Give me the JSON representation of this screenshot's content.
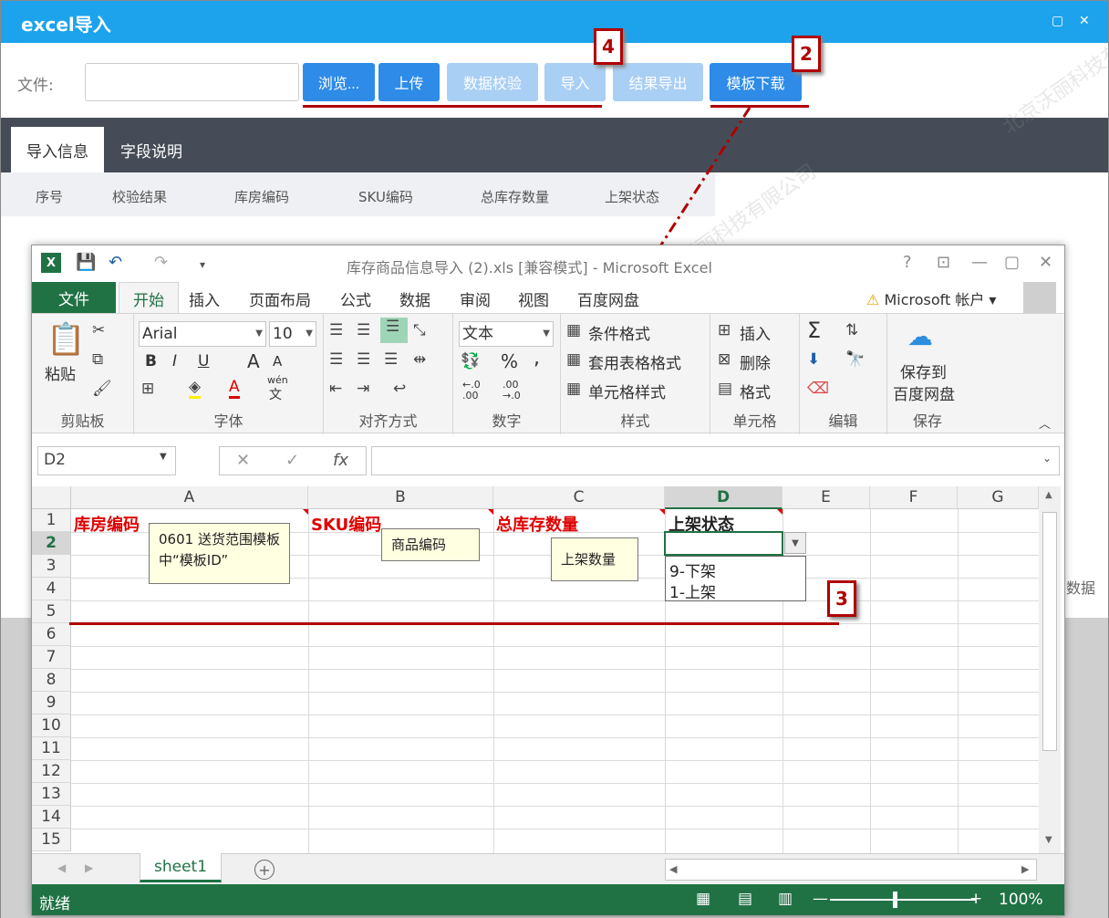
{
  "dialog": {
    "title": "excel导入",
    "file_label": "文件:",
    "buttons": {
      "browse": "浏览...",
      "upload": "上传",
      "validate": "数据校验",
      "import": "导入",
      "export": "结果导出",
      "template": "模板下载"
    },
    "tabs": [
      "导入信息",
      "字段说明"
    ],
    "columns": [
      "序号",
      "校验结果",
      "库房编码",
      "SKU编码",
      "总库存数量",
      "上架状态"
    ],
    "side_text": "数据",
    "watermark": "北京沃丽科技有限公司"
  },
  "annotations": {
    "tag2": "2",
    "tag3": "3",
    "tag4": "4"
  },
  "excel": {
    "logo": "X",
    "title": "库存商品信息导入 (2).xls [兼容模式] - Microsoft Excel",
    "help": "?",
    "menus": {
      "file": "文件",
      "home": "开始",
      "items": [
        "插入",
        "页面布局",
        "公式",
        "数据",
        "审阅",
        "视图",
        "百度网盘"
      ]
    },
    "account": "Microsoft 帐户",
    "ribbon": {
      "clipboard": {
        "paste": "粘贴",
        "label": "剪贴板"
      },
      "font": {
        "name": "Arial",
        "size": "10",
        "bold": "B",
        "italic": "I",
        "underline": "U",
        "grow": "A",
        "shrink": "A",
        "wen": "wén",
        "wen2": "文",
        "label": "字体"
      },
      "align": {
        "label": "对齐方式"
      },
      "number": {
        "format": "文本",
        "percent": "%",
        "comma": ",",
        "inc": "←.0 .00",
        "dec": ".00 →.0",
        "label": "数字"
      },
      "styles": {
        "cond": "条件格式",
        "table": "套用表格格式",
        "cell": "单元格样式",
        "label": "样式"
      },
      "cells": {
        "insert": "插入",
        "delete": "删除",
        "format": "格式",
        "label": "单元格"
      },
      "edit": {
        "sum": "Σ",
        "label": "编辑"
      },
      "save": {
        "line1": "保存到",
        "line2": "百度网盘",
        "label": "保存"
      }
    },
    "namebox": "D2",
    "fx": "fx",
    "cancel_icon": "✕",
    "ok_icon": "✓",
    "columns": [
      "A",
      "B",
      "C",
      "D",
      "E",
      "F",
      "G"
    ],
    "rows": [
      "1",
      "2",
      "3",
      "4",
      "5",
      "6",
      "7",
      "8",
      "9",
      "10",
      "11",
      "12",
      "13",
      "14",
      "15"
    ],
    "cells": {
      "A1": "库房编码",
      "B1": "SKU编码",
      "C1": "总库存数量",
      "D1": "上架状态"
    },
    "comments": {
      "A": "0601 送货范围模板中“模板ID”",
      "B": "商品编码",
      "C": "上架数量"
    },
    "dropdown": [
      "9-下架",
      "1-上架"
    ],
    "sheet": "sheet1",
    "status": "就绪",
    "zoom": "100%"
  },
  "colors": {
    "accent": "#1ca3ec",
    "excel_green": "#207245",
    "annotation_red": "#b00000"
  }
}
